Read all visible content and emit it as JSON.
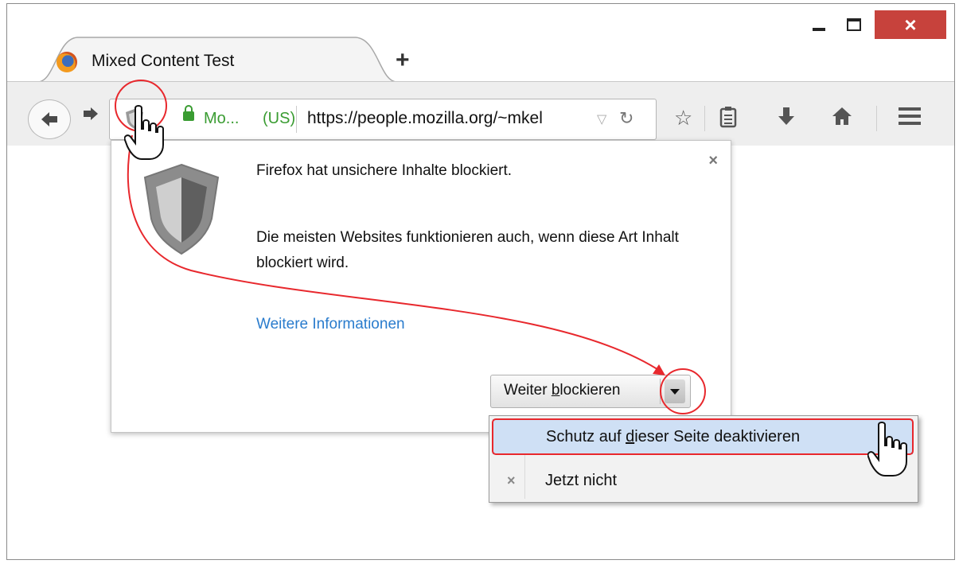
{
  "window": {
    "controls": {
      "minimize": "minimize",
      "maximize": "maximize",
      "close": "×"
    }
  },
  "tab": {
    "title": "Mixed Content Test",
    "new_tab_label": "+"
  },
  "navbar": {
    "identity_label": "Mo...",
    "country_label": "(US)",
    "url": "https://people.mozilla.org/~mkel",
    "icons": [
      "back-arrow-icon",
      "forward-arrow-icon",
      "shield-icon",
      "lock-icon",
      "dropmarker-icon",
      "reload-icon",
      "star-icon",
      "reading-list-icon",
      "download-icon",
      "home-icon",
      "menu-icon"
    ]
  },
  "panel": {
    "close_label": "×",
    "line1": "Firefox hat unsichere Inhalte blockiert.",
    "line2": "Die meisten Websites funktionieren auch, wenn diese Art Inhalt blockiert wird.",
    "link": "Weitere Informationen",
    "button_label_before": "Weiter ",
    "button_label_accel": "b",
    "button_label_after": "lockieren"
  },
  "menu": {
    "item1_before": "Schutz auf ",
    "item1_accel": "d",
    "item1_after": "ieser Seite deaktivieren",
    "item2_icon": "×",
    "item2_label": "Jetzt nicht"
  },
  "colors": {
    "annotation": "#e8282d",
    "secure_green": "#3a9c32",
    "link_blue": "#2a7ccd",
    "close_red": "#c7423c",
    "menu_highlight": "#cfe0f5"
  }
}
